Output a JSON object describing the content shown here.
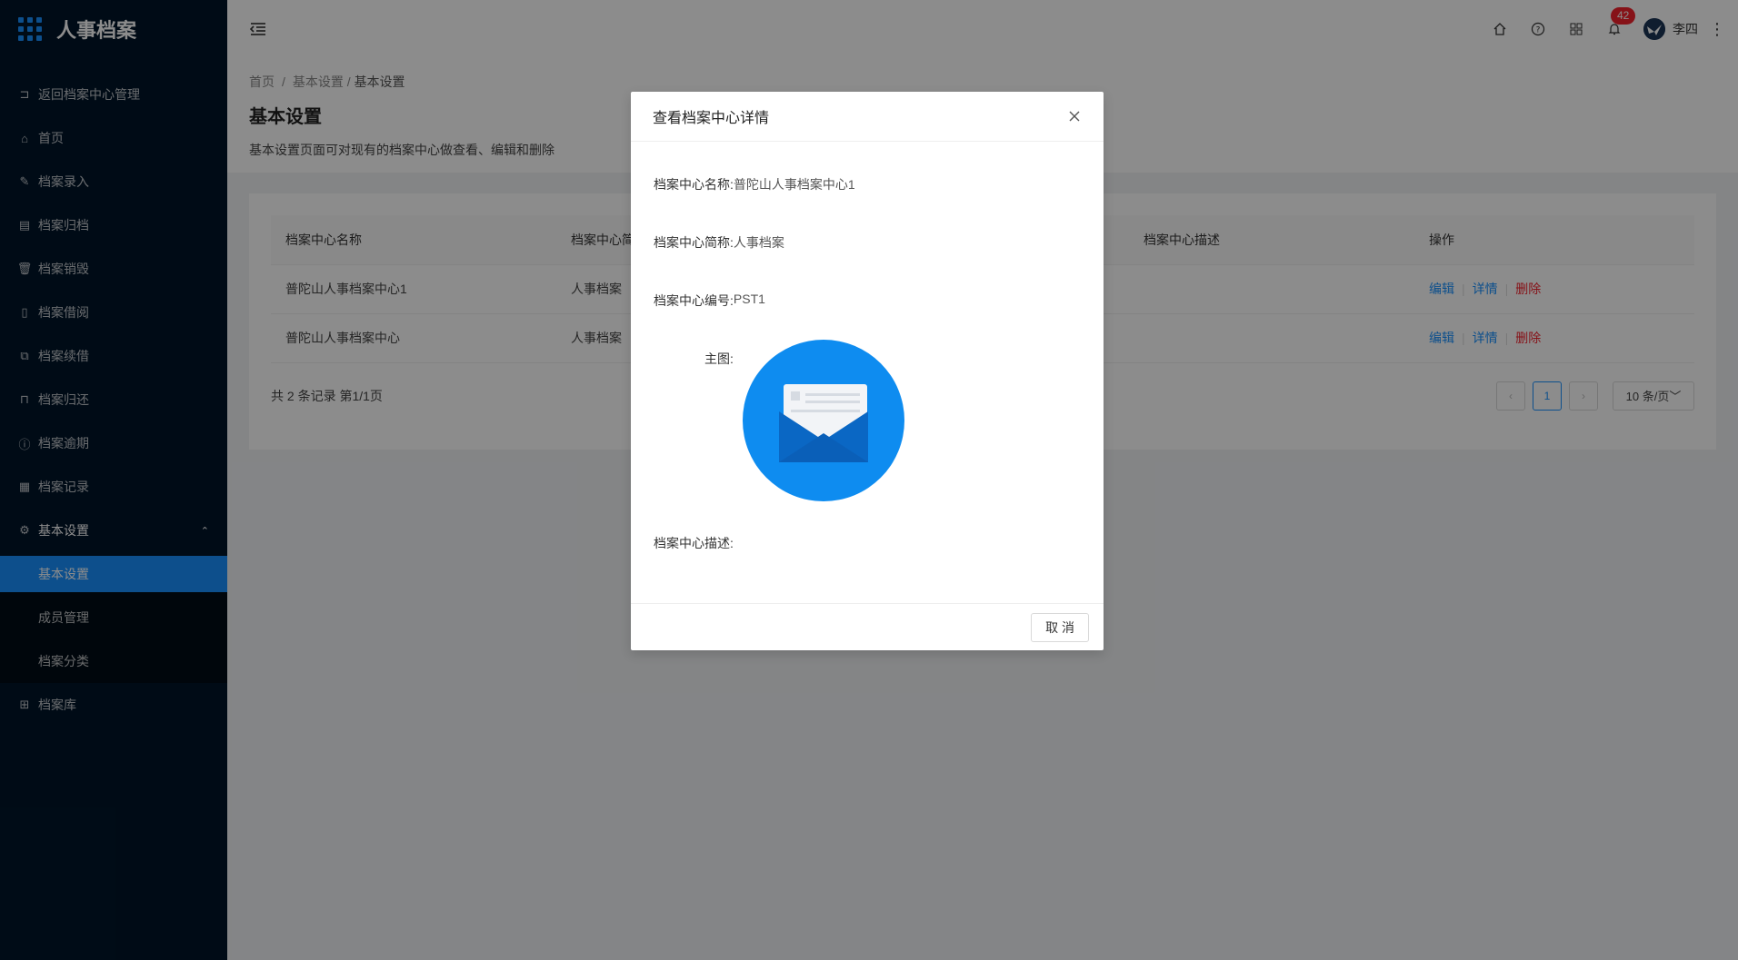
{
  "app": {
    "title": "人事档案"
  },
  "sidebar": {
    "items": [
      {
        "label": "返回档案中心管理",
        "icon": "back-icon"
      },
      {
        "label": "首页",
        "icon": "home-icon"
      },
      {
        "label": "档案录入",
        "icon": "edit-icon"
      },
      {
        "label": "档案归档",
        "icon": "file-icon"
      },
      {
        "label": "档案销毁",
        "icon": "trash-icon"
      },
      {
        "label": "档案借阅",
        "icon": "doc-icon"
      },
      {
        "label": "档案续借",
        "icon": "copy-icon"
      },
      {
        "label": "档案归还",
        "icon": "lock-icon"
      },
      {
        "label": "档案逾期",
        "icon": "info-icon"
      },
      {
        "label": "档案记录",
        "icon": "record-icon"
      }
    ],
    "settings": {
      "label": "基本设置",
      "icon": "gear-icon"
    },
    "sub_items": [
      {
        "label": "基本设置"
      },
      {
        "label": "成员管理"
      },
      {
        "label": "档案分类"
      }
    ],
    "library": {
      "label": "档案库",
      "icon": "grid-icon"
    }
  },
  "header": {
    "notification_count": "42",
    "username": "李四"
  },
  "page": {
    "breadcrumb": [
      "首页",
      "基本设置",
      "基本设置"
    ],
    "title": "基本设置",
    "description": "基本设置页面可对现有的档案中心做查看、编辑和删除"
  },
  "table": {
    "headers": [
      "档案中心名称",
      "档案中心简",
      "档案中心描述",
      "操作"
    ],
    "rows": [
      {
        "name": "普陀山人事档案中心1",
        "short": "人事档案"
      },
      {
        "name": "普陀山人事档案中心",
        "short": "人事档案"
      }
    ],
    "actions": {
      "edit": "编辑",
      "detail": "详情",
      "delete": "删除"
    },
    "total": "共 2 条记录 第1/1页",
    "current_page": "1",
    "page_size": "10 条/页"
  },
  "modal": {
    "title": "查看档案中心详情",
    "fields": {
      "name_label": "档案中心名称:",
      "name_value": "普陀山人事档案中心1",
      "short_label": "档案中心简称:",
      "short_value": "人事档案",
      "code_label": "档案中心编号:",
      "code_value": "PST1",
      "image_label": "主图:",
      "desc_label": "档案中心描述:"
    },
    "cancel": "取 消"
  },
  "colors": {
    "primary": "#1890ff",
    "sidebar": "#001529",
    "danger": "#f5222d"
  }
}
